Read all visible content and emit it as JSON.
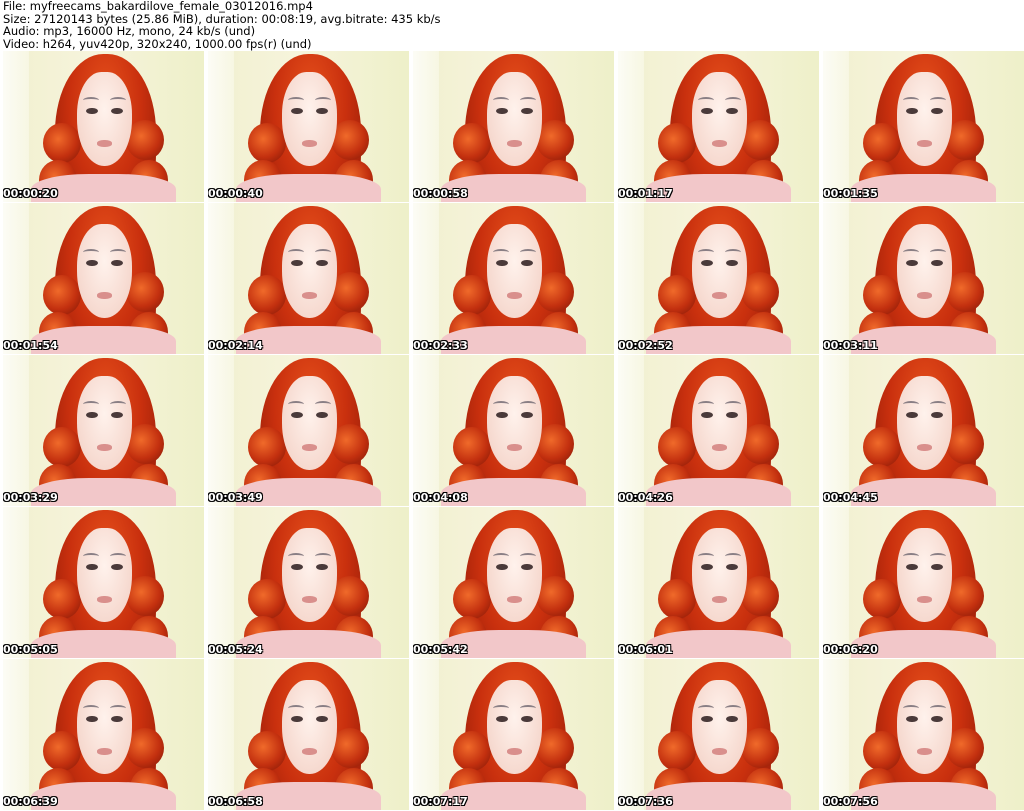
{
  "header": {
    "file": "File: myfreecams_bakardilove_female_03012016.mp4",
    "size": "Size: 27120143 bytes (25.86 MiB), duration: 00:08:19, avg.bitrate: 435 kb/s",
    "audio": "Audio: mp3, 16000 Hz, mono, 24 kb/s (und)",
    "video": "Video: h264, yuv420p, 320x240, 1000.00 fps(r) (und)"
  },
  "thumbnails": [
    {
      "time": "00:00:20"
    },
    {
      "time": "00:00:40"
    },
    {
      "time": "00:00:58"
    },
    {
      "time": "00:01:17"
    },
    {
      "time": "00:01:35"
    },
    {
      "time": "00:01:54"
    },
    {
      "time": "00:02:14"
    },
    {
      "time": "00:02:33"
    },
    {
      "time": "00:02:52"
    },
    {
      "time": "00:03:11"
    },
    {
      "time": "00:03:29"
    },
    {
      "time": "00:03:49"
    },
    {
      "time": "00:04:08"
    },
    {
      "time": "00:04:26"
    },
    {
      "time": "00:04:45"
    },
    {
      "time": "00:05:05"
    },
    {
      "time": "00:05:24"
    },
    {
      "time": "00:05:42"
    },
    {
      "time": "00:06:01"
    },
    {
      "time": "00:06:20"
    },
    {
      "time": "00:06:39"
    },
    {
      "time": "00:06:58"
    },
    {
      "time": "00:07:17"
    },
    {
      "time": "00:07:36"
    },
    {
      "time": "00:07:56"
    }
  ]
}
